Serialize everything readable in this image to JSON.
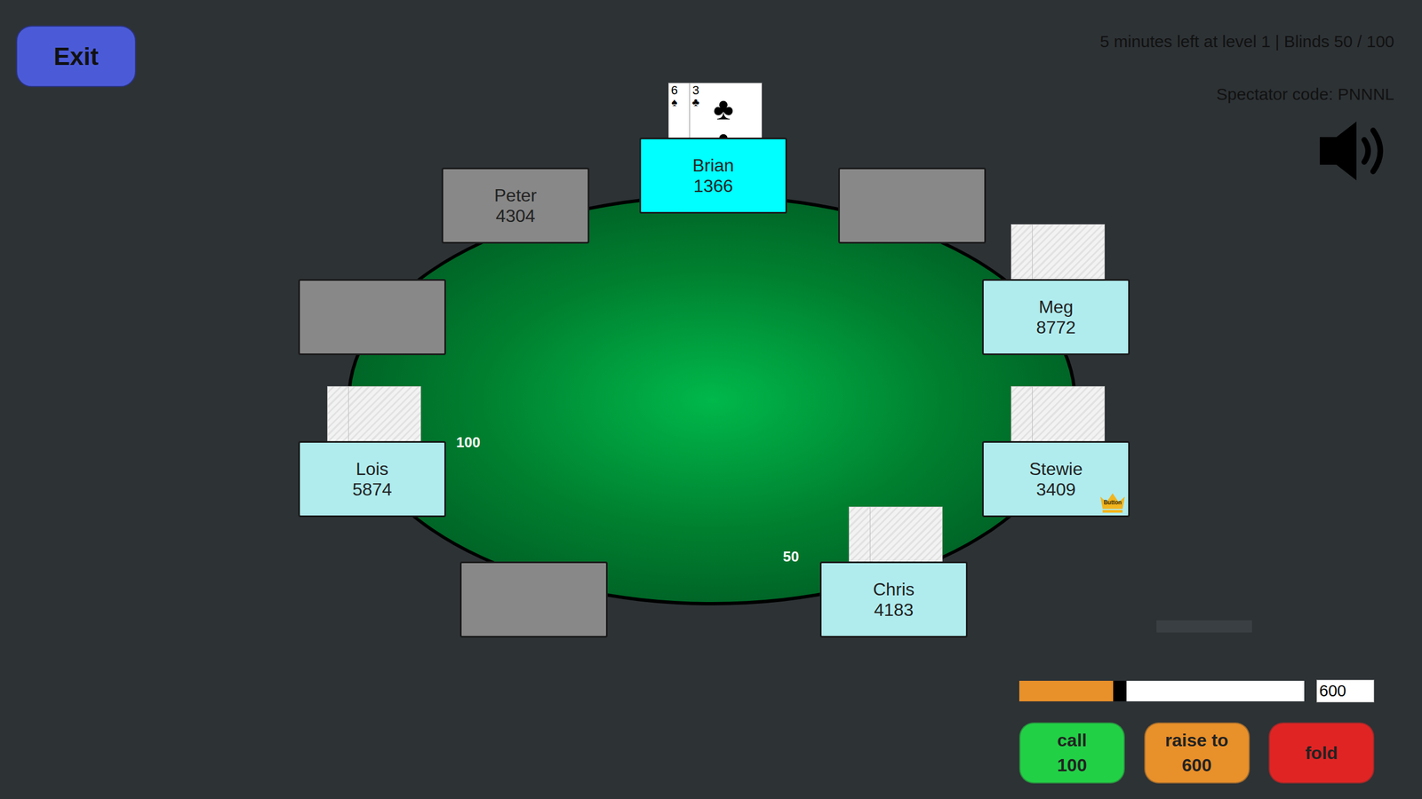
{
  "exit_button": "Exit",
  "level_info": "5 minutes left at level 1 | Blinds 50 / 100",
  "spectator_code": "Spectator code: PNNNL",
  "seats": [
    {
      "kind": "player",
      "name": "Peter",
      "chips": "4304",
      "active": false,
      "folded": true,
      "dealer": false,
      "hand": {
        "kind": "none"
      }
    },
    {
      "kind": "player",
      "name": "Brian",
      "chips": "1366",
      "active": true,
      "folded": false,
      "dealer": false,
      "hand": {
        "kind": "face-up",
        "cards": [
          {
            "rank": "6",
            "suit": "♠"
          },
          {
            "rank": "3",
            "suit": "♣"
          }
        ]
      }
    },
    {
      "kind": "empty"
    },
    {
      "kind": "player",
      "name": "Meg",
      "chips": "8772",
      "active": false,
      "folded": false,
      "dealer": false,
      "hand": {
        "kind": "face-down"
      }
    },
    {
      "kind": "player",
      "name": "Stewie",
      "chips": "3409",
      "active": false,
      "folded": false,
      "dealer": true,
      "badge": "Button",
      "hand": {
        "kind": "face-down"
      }
    },
    {
      "kind": "player",
      "name": "Chris",
      "chips": "4183",
      "active": false,
      "folded": false,
      "dealer": false,
      "bet": "50",
      "hand": {
        "kind": "face-down"
      }
    },
    {
      "kind": "empty"
    },
    {
      "kind": "player",
      "name": "Lois",
      "chips": "5874",
      "active": false,
      "folded": false,
      "dealer": false,
      "bet": "100",
      "hand": {
        "kind": "face-down"
      }
    },
    {
      "kind": "empty"
    }
  ],
  "raise_slider": {
    "level": 0.33,
    "value": "600"
  },
  "buttons": [
    {
      "kind": "call",
      "label": "call",
      "amount": "100"
    },
    {
      "kind": "raise",
      "label": "raise to",
      "amount": "600"
    },
    {
      "kind": "fold",
      "label": "fold"
    }
  ]
}
